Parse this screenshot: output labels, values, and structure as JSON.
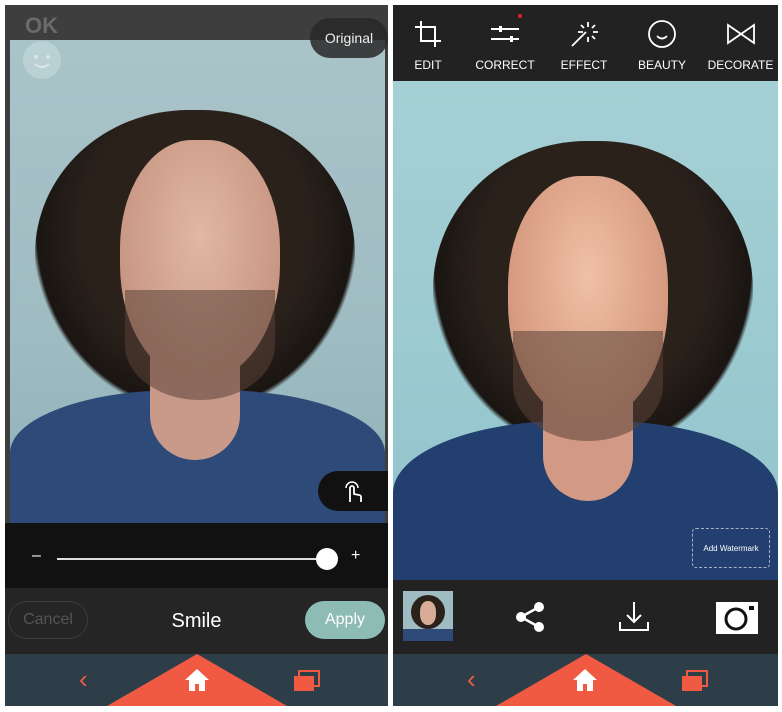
{
  "left": {
    "ok_label": "OK",
    "original_label": "Original",
    "slider": {
      "min_label": "–",
      "max_label": "+",
      "value_percent": 100
    },
    "cancel_label": "Cancel",
    "title": "Smile",
    "apply_label": "Apply",
    "icons": [
      "smiley-icon",
      "touch-gesture-icon"
    ]
  },
  "right": {
    "toolbar": [
      {
        "label": "EDIT",
        "icon": "crop-icon"
      },
      {
        "label": "CORRECT",
        "icon": "sliders-icon"
      },
      {
        "label": "EFFECT",
        "icon": "magic-wand-icon"
      },
      {
        "label": "BEAUTY",
        "icon": "smile-icon"
      },
      {
        "label": "DECORATE",
        "icon": "bow-tie-icon"
      }
    ],
    "watermark_label": "Add Watermark",
    "actions": [
      "thumbnail",
      "share-icon",
      "download-icon",
      "camera-icon"
    ]
  },
  "nav": {
    "icons": [
      "back-icon",
      "home-icon",
      "recent-apps-icon"
    ]
  },
  "colors": {
    "accent": "#f05a42",
    "apply": "#8cbcb4",
    "nav_bg": "#2e3e48",
    "notification_dot": "#e0203a"
  }
}
